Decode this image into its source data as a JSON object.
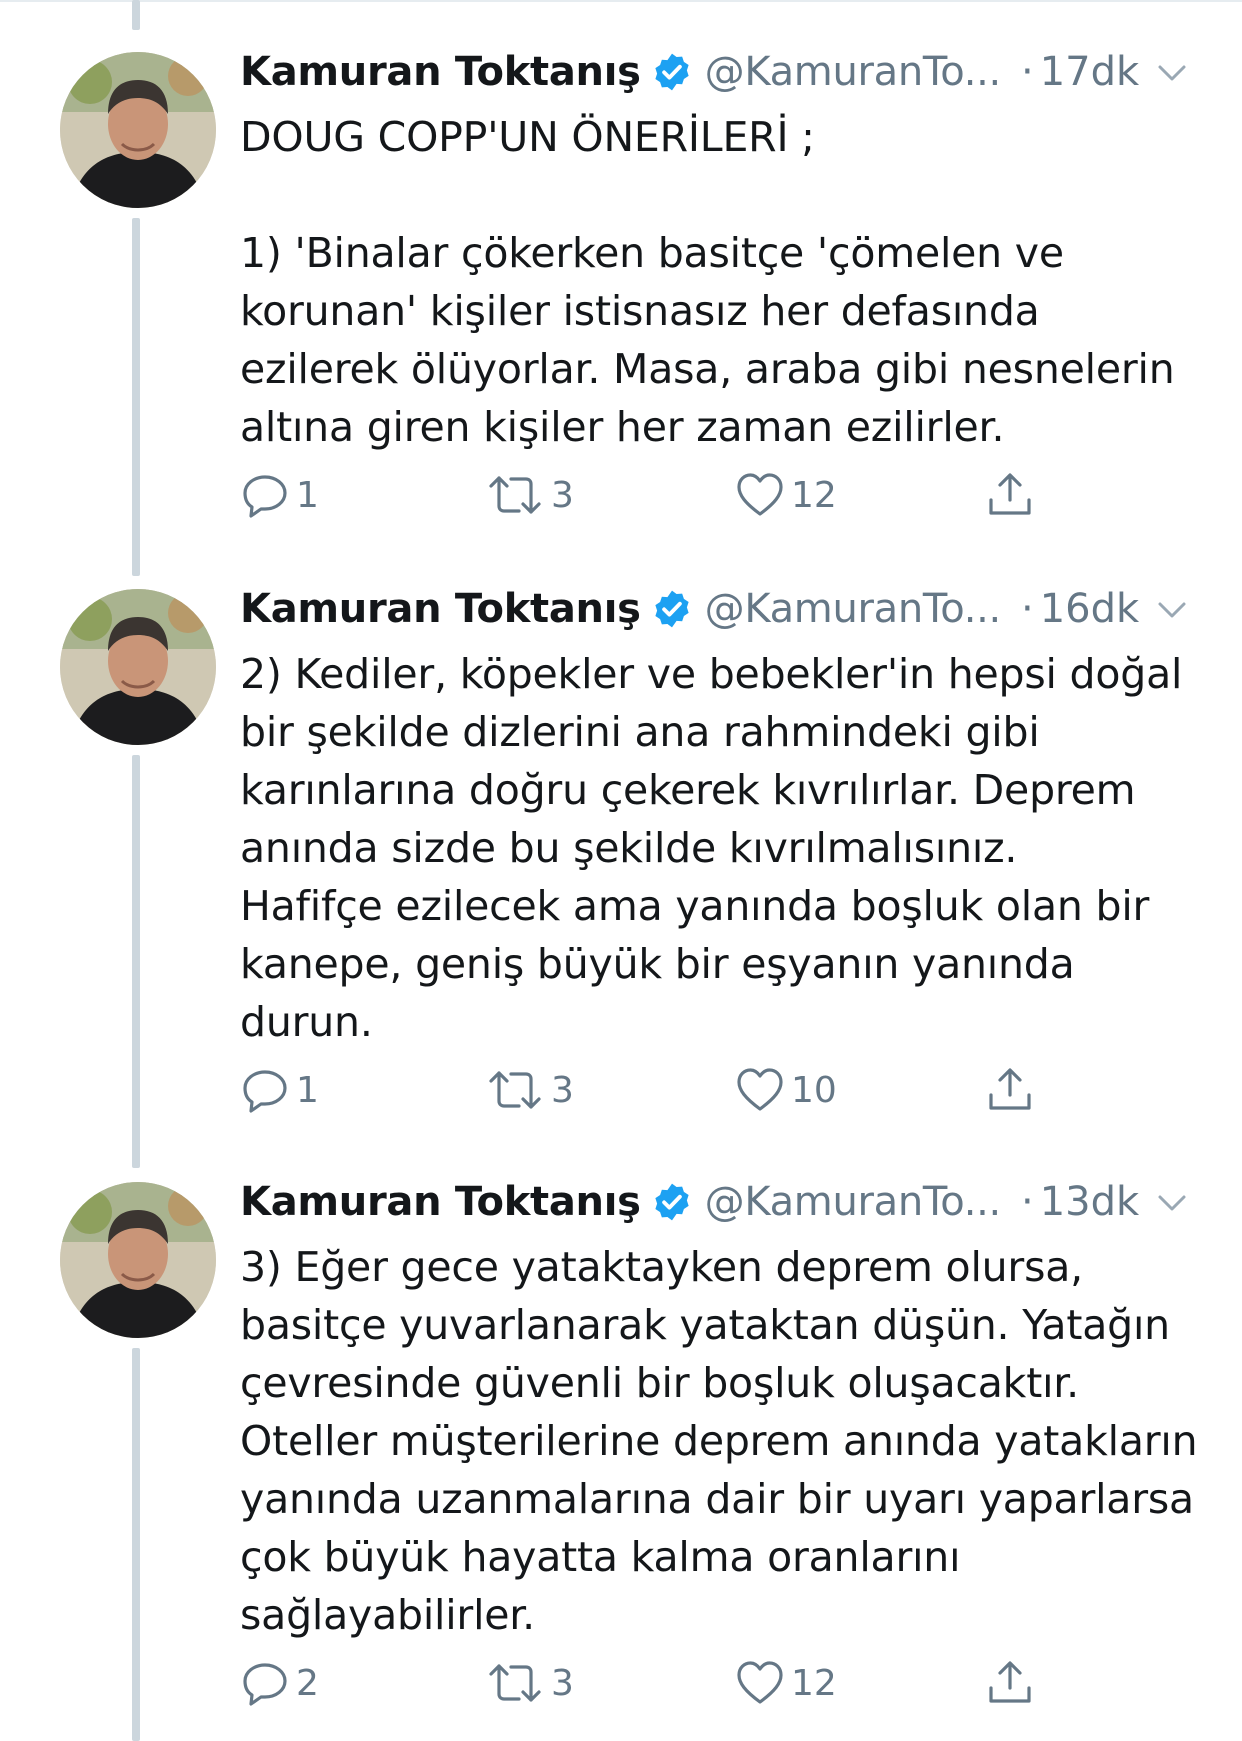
{
  "tweets": [
    {
      "author_name": "Kamuran Toktanış",
      "handle": "@KamuranTo...",
      "time": "17dk",
      "text": "DOUG COPP'UN ÖNERİLERİ ;\n\n1) 'Binalar çökerken basitçe 'çömelen ve\nkorunan' kişiler istisnasız her defasında\nezilerek ölüyorlar. Masa, araba gibi nesnelerin\naltına giren kişiler her zaman ezilirler.",
      "replies": "1",
      "retweets": "3",
      "likes": "12"
    },
    {
      "author_name": "Kamuran Toktanış",
      "handle": "@KamuranTo...",
      "time": "16dk",
      "text": "2) Kediler, köpekler ve bebekler'in hepsi doğal\nbir şekilde dizlerini ana rahmindeki gibi\nkarınlarına doğru çekerek kıvrılırlar. Deprem\nanında sizde bu şekilde kıvrılmalısınız.\nHafifçe ezilecek ama yanında boşluk olan bir\nkanepe, geniş büyük bir eşyanın yanında\ndurun.",
      "replies": "1",
      "retweets": "3",
      "likes": "10"
    },
    {
      "author_name": "Kamuran Toktanış",
      "handle": "@KamuranTo...",
      "time": "13dk",
      "text": "3) Eğer gece yataktayken deprem olursa,\nbasitçe yuvarlanarak yataktan düşün. Yatağın\nçevresinde güvenli bir boşluk oluşacaktır.\nOteller müşterilerine deprem anında yatakların\nyanında uzanmalarına dair bir uyarı yaparlarsa\nçok büyük hayatta kalma oranlarını\nsağlayabilirler.",
      "replies": "2",
      "retweets": "3",
      "likes": "12"
    }
  ],
  "separator": "·",
  "colors": {
    "text": "#14171a",
    "secondary": "#657786",
    "verified": "#1da1f2",
    "thread_line": "#ccd6dd"
  },
  "icons": [
    "verified-badge-icon",
    "chevron-down-icon",
    "reply-icon",
    "retweet-icon",
    "like-icon",
    "share-icon"
  ]
}
